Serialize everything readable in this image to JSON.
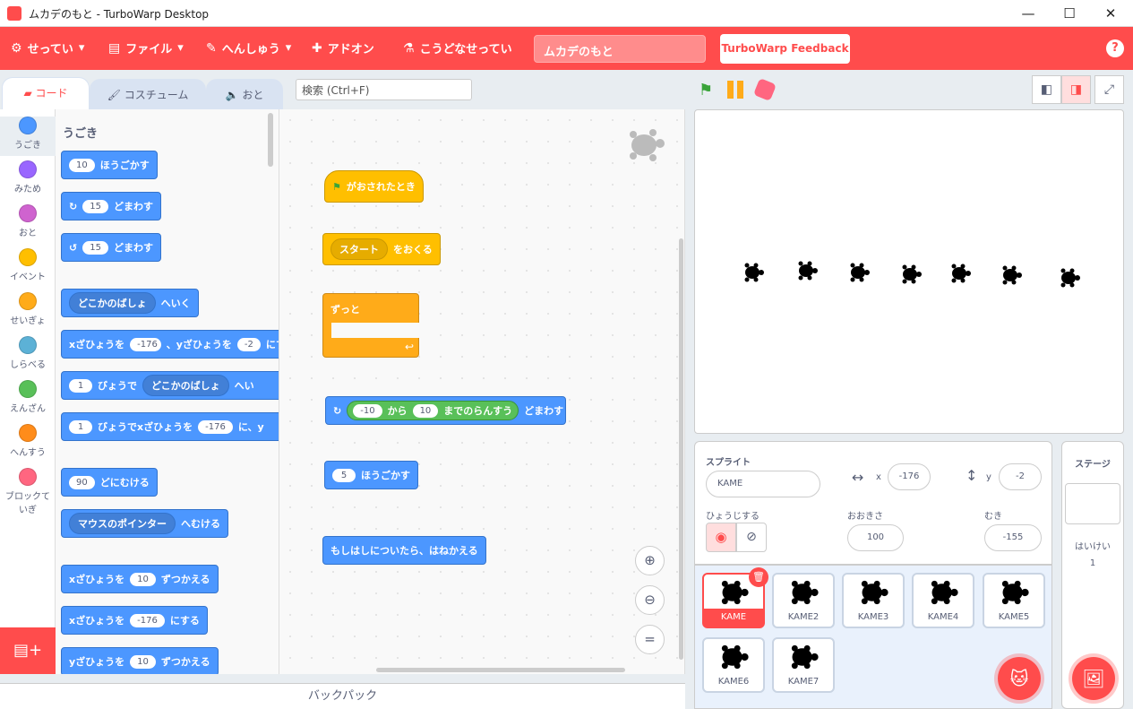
{
  "window": {
    "title": "ムカデのもと - TurboWarp Desktop",
    "min": "—",
    "max": "☐",
    "close": "✕"
  },
  "menu": {
    "settings": "せってい",
    "file": "ファイル",
    "edit": "へんしゅう",
    "addons": "アドオン",
    "howto": "こうどなせってい",
    "project_title": "ムカデのもと",
    "feedback": "TurboWarp Feedback",
    "help": "?"
  },
  "tabs": {
    "code": "コード",
    "costume": "コスチューム",
    "sound": "おと"
  },
  "search": {
    "placeholder": "検索 (Ctrl+F)"
  },
  "categories": [
    {
      "label": "うごき",
      "color": "#4c97ff"
    },
    {
      "label": "みため",
      "color": "#9966ff"
    },
    {
      "label": "おと",
      "color": "#cf63cf"
    },
    {
      "label": "イベント",
      "color": "#ffbf00"
    },
    {
      "label": "せいぎょ",
      "color": "#ffab19"
    },
    {
      "label": "しらべる",
      "color": "#5cb1d6"
    },
    {
      "label": "えんざん",
      "color": "#59c059"
    },
    {
      "label": "へんすう",
      "color": "#ff8c1a"
    },
    {
      "label": "ブロックていぎ",
      "color": "#ff6680"
    }
  ],
  "palette": {
    "heading": "うごき",
    "b1": {
      "n": "10",
      "t": "ほうごかす"
    },
    "b2": {
      "n": "15",
      "t": "どまわす"
    },
    "b3": {
      "n": "15",
      "t": "どまわす"
    },
    "b4": {
      "dd": "どこかのばしょ",
      "t": "へいく"
    },
    "b5": {
      "a": "xざひょうを",
      "x": "-176",
      "b": "、yざひょうを",
      "y": "-2",
      "c": "にす"
    },
    "b6": {
      "n": "1",
      "a": "びょうで",
      "dd": "どこかのばしょ",
      "t": "へい"
    },
    "b7": {
      "n": "1",
      "a": "びょうでxざひょうを",
      "x": "-176",
      "t": "に、y"
    },
    "b8": {
      "n": "90",
      "t": "どにむける"
    },
    "b9": {
      "dd": "マウスのポインター",
      "t": "へむける"
    },
    "b10": {
      "a": "xざひょうを",
      "n": "10",
      "t": "ずつかえる"
    },
    "b11": {
      "a": "xざひょうを",
      "n": "-176",
      "t": "にする"
    },
    "b12": {
      "a": "yざひょうを",
      "n": "10",
      "t": "ずつかえる"
    }
  },
  "scripts": {
    "flag": "がおされたとき",
    "broadcast": {
      "dd": "スタート",
      "t": "をおくる"
    },
    "forever": "ずっと",
    "turn": {
      "from": "-10",
      "a": "から",
      "to": "10",
      "b": "までのらんすう",
      "t": "どまわす"
    },
    "move": {
      "n": "5",
      "t": "ほうごかす"
    },
    "bounce": "もしはしについたら、はねかえる"
  },
  "backpack": "バックパック",
  "sprite_info": {
    "label": "スプライト",
    "name": "KAME",
    "x_label": "x",
    "x": "-176",
    "y_label": "y",
    "y": "-2",
    "show_label": "ひょうじする",
    "size_label": "おおきさ",
    "size": "100",
    "dir_label": "むき",
    "dir": "-155"
  },
  "sprites": [
    "KAME",
    "KAME2",
    "KAME3",
    "KAME4",
    "KAME5",
    "KAME6",
    "KAME7"
  ],
  "stage_panel": {
    "label": "ステージ",
    "backdrops_label": "はいけい",
    "backdrops": "1"
  }
}
